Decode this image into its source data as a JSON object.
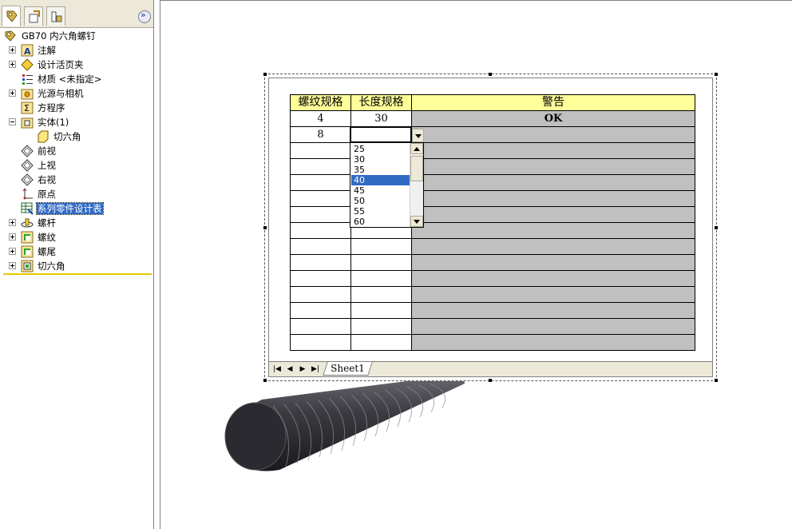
{
  "tree": {
    "root": "GB70  内六角螺钉",
    "items": [
      {
        "label": "注解",
        "icon": "annotation-icon",
        "expander": "plus"
      },
      {
        "label": "设计活页夹",
        "icon": "design-binder-icon",
        "expander": "plus"
      },
      {
        "label": "材质 <未指定>",
        "icon": "material-icon",
        "expander": "none"
      },
      {
        "label": "光源与相机",
        "icon": "lights-camera-icon",
        "expander": "plus"
      },
      {
        "label": "方程序",
        "icon": "equations-icon",
        "expander": "none"
      },
      {
        "label": "实体(1)",
        "icon": "solid-bodies-icon",
        "expander": "minus"
      },
      {
        "label": "切六角",
        "icon": "body-icon",
        "expander": "none"
      },
      {
        "label": "前视",
        "icon": "plane-icon",
        "expander": "none"
      },
      {
        "label": "上视",
        "icon": "plane-icon",
        "expander": "none"
      },
      {
        "label": "右视",
        "icon": "plane-icon",
        "expander": "none"
      },
      {
        "label": "原点",
        "icon": "origin-icon",
        "expander": "none"
      },
      {
        "label": "系列零件设计表",
        "icon": "design-table-icon",
        "expander": "none",
        "selected": true
      },
      {
        "label": "螺杆",
        "icon": "revolve-icon",
        "expander": "plus"
      },
      {
        "label": "螺纹",
        "icon": "thread-icon",
        "expander": "plus"
      },
      {
        "label": "螺尾",
        "icon": "thread-icon",
        "expander": "plus"
      },
      {
        "label": "切六角",
        "icon": "cut-extrude-icon",
        "expander": "plus"
      }
    ]
  },
  "worksheet": {
    "headers": [
      "螺纹规格",
      "长度规格",
      "警告"
    ],
    "rows": [
      [
        "4",
        "30",
        "OK"
      ],
      [
        "8",
        "",
        ""
      ]
    ],
    "dropdown_options": [
      "25",
      "30",
      "35",
      "40",
      "45",
      "50",
      "55",
      "60"
    ],
    "dropdown_selected": "40",
    "sheet_tab": "Sheet1",
    "nav_buttons": [
      "|◀",
      "◀",
      "▶",
      "▶|"
    ]
  },
  "colors": {
    "header_bg": "#ffff99",
    "warning_bg": "#c0c0c0",
    "selection": "#316ac5",
    "tree_end_line": "#e6c800"
  }
}
